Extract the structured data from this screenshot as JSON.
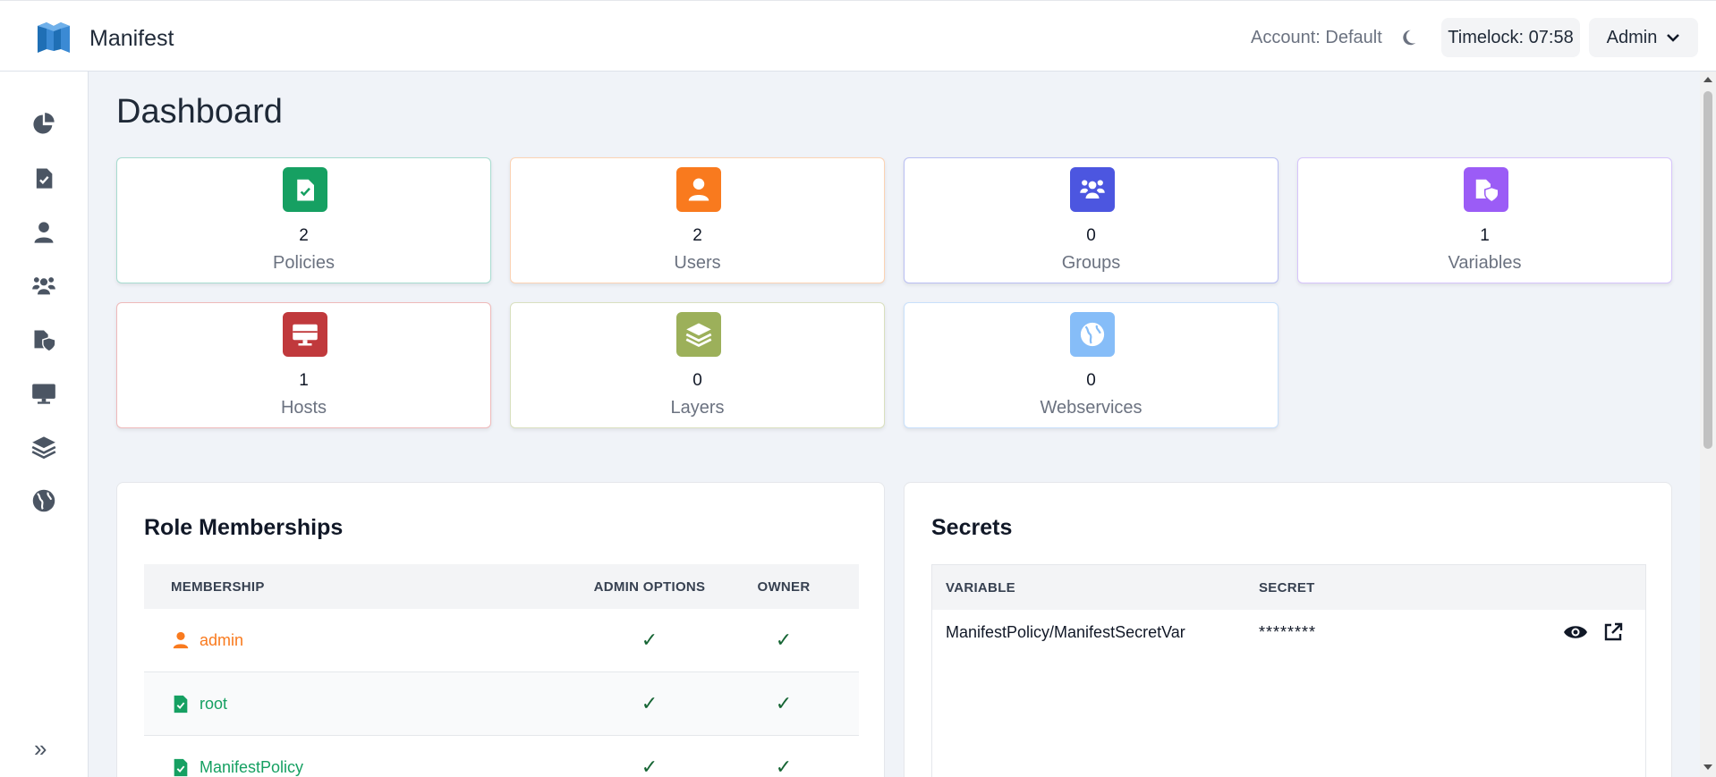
{
  "header": {
    "app_title": "Manifest",
    "account_label": "Account: Default",
    "timelock_label": "Timelock: 07:58",
    "user_menu_label": "Admin",
    "theme_icon": "moon-icon"
  },
  "sidebar": {
    "items": [
      {
        "name": "dashboard",
        "icon": "pie-chart-icon"
      },
      {
        "name": "policies",
        "icon": "clipboard-check-icon"
      },
      {
        "name": "users",
        "icon": "user-icon"
      },
      {
        "name": "groups",
        "icon": "users-icon"
      },
      {
        "name": "variables",
        "icon": "file-shield-icon"
      },
      {
        "name": "hosts",
        "icon": "desktop-icon"
      },
      {
        "name": "layers",
        "icon": "layers-icon"
      },
      {
        "name": "webservices",
        "icon": "globe-icon"
      }
    ],
    "collapse_label": "»"
  },
  "page": {
    "title": "Dashboard"
  },
  "cards": [
    {
      "count": "2",
      "label": "Policies",
      "color": "#16a062",
      "border": "#a7dcd0"
    },
    {
      "count": "2",
      "label": "Users",
      "color": "#f97a1e",
      "border": "#fcd3b4"
    },
    {
      "count": "0",
      "label": "Groups",
      "color": "#4c56e0",
      "border": "#b9bef3"
    },
    {
      "count": "1",
      "label": "Variables",
      "color": "#9b5cf6",
      "border": "#d6c4fb"
    },
    {
      "count": "1",
      "label": "Hosts",
      "color": "#c0393c",
      "border": "#efb9ba"
    },
    {
      "count": "0",
      "label": "Layers",
      "color": "#9cb05a",
      "border": "#d9e0bf"
    },
    {
      "count": "0",
      "label": "Webservices",
      "color": "#86bdf8",
      "border": "#c8e0fb"
    }
  ],
  "role_memberships": {
    "title": "Role Memberships",
    "columns": [
      "MEMBERSHIP",
      "ADMIN OPTIONS",
      "OWNER"
    ],
    "rows": [
      {
        "name": "admin",
        "type": "user",
        "color": "#f97a1e",
        "admin": "✓",
        "owner": "✓"
      },
      {
        "name": "root",
        "type": "policy",
        "color": "#16a062",
        "admin": "✓",
        "owner": "✓"
      },
      {
        "name": "ManifestPolicy",
        "type": "policy",
        "color": "#16a062",
        "admin": "✓",
        "owner": "✓"
      }
    ]
  },
  "secrets": {
    "title": "Secrets",
    "columns": [
      "VARIABLE",
      "SECRET"
    ],
    "rows": [
      {
        "variable": "ManifestPolicy/ManifestSecretVar",
        "secret": "********"
      }
    ]
  }
}
